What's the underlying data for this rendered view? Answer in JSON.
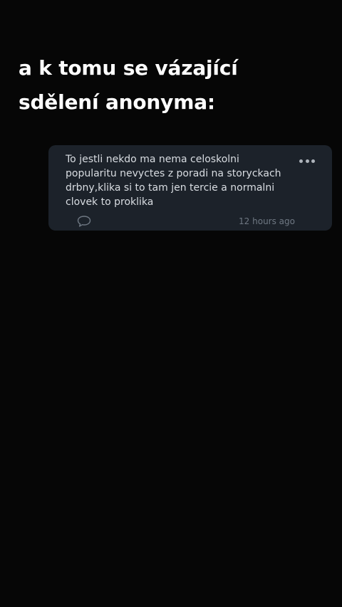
{
  "caption": {
    "line1": "a k tomu se vázající",
    "line2": "sdělení anonyma:"
  },
  "message": {
    "lines": [
      "To jestli nekdo ma nema celoskolni",
      "popularitu nevyctes z poradi na storyckach",
      "drbny,klika si to tam jen tercie a normalni",
      "clovek to proklika"
    ],
    "timestamp": "12 hours ago",
    "more_icon": "more-horizontal-icon",
    "comment_icon": "speech-bubble-icon"
  },
  "colors": {
    "background": "#060606",
    "card": "#1c222a",
    "text": "#d9dde2",
    "muted": "#6f7883"
  }
}
